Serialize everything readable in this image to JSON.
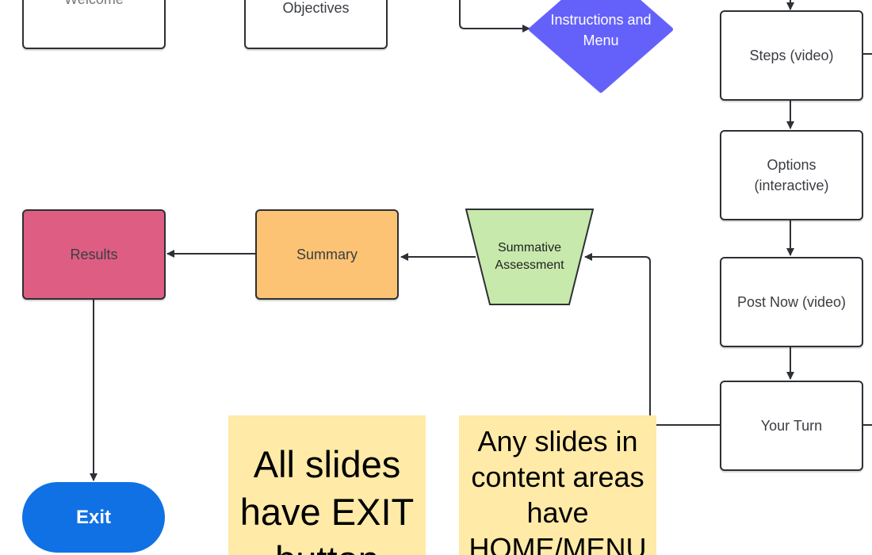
{
  "nodes": {
    "welcome": "Welcome",
    "objectives": "Objectives",
    "instructions": "Instructions and Menu",
    "steps": "Steps (video)",
    "options": "Options (interactive)",
    "post_now": "Post Now (video)",
    "your_turn": "Your Turn",
    "summative": "Summative Assessment",
    "summary": "Summary",
    "results": "Results",
    "exit": "Exit"
  },
  "notes": {
    "exit_note": "All slides have EXIT button",
    "menu_note": "Any slides in content areas have HOME/MENU"
  },
  "colors": {
    "instructions": "#6461fb",
    "summative": "#c7e9ab",
    "summary": "#fdc374",
    "results": "#de5d83",
    "exit": "#1071e5",
    "note": "#ffeaa7"
  }
}
